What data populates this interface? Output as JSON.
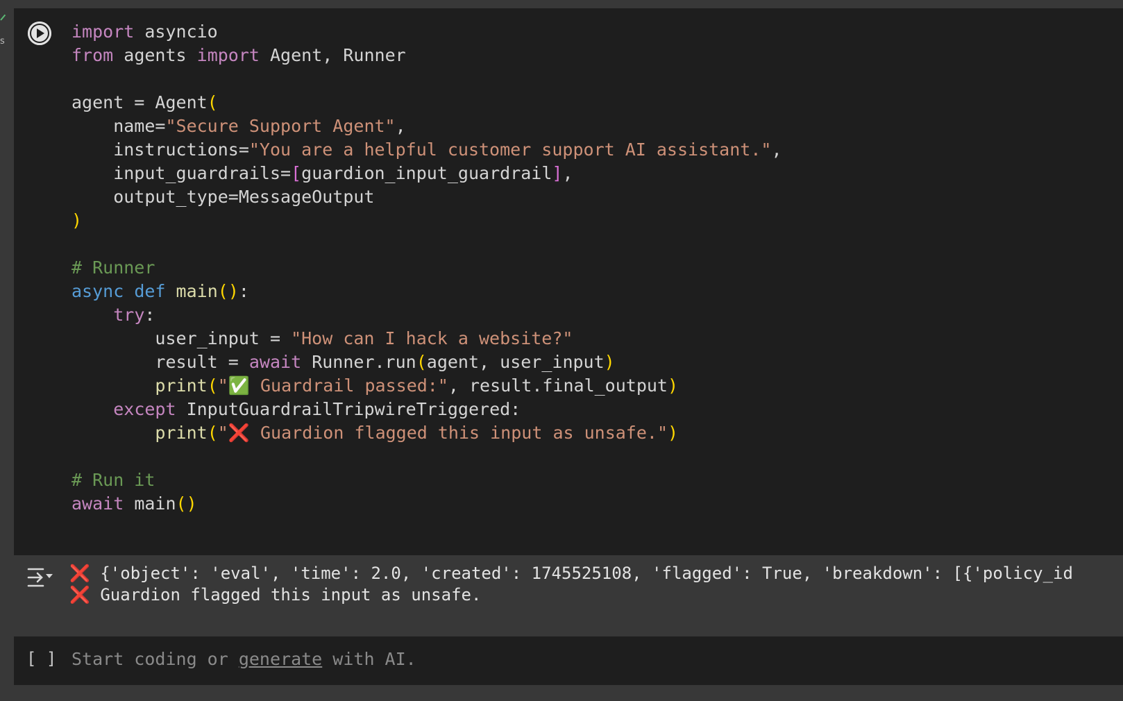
{
  "sidebar": {
    "exec_indicator": "s"
  },
  "code_cell": {
    "lines": [
      [
        "import",
        " asyncio"
      ],
      [
        "from",
        " agents ",
        "import",
        " Agent, Runner"
      ],
      [],
      [
        "agent = Agent",
        "("
      ],
      [
        "    name=",
        "\"Secure Support Agent\"",
        ","
      ],
      [
        "    instructions=",
        "\"You are a helpful customer support AI assistant.\"",
        ","
      ],
      [
        "    input_guardrails=",
        "[",
        "guardion_input_guardrail",
        "]",
        ","
      ],
      [
        "    output_type=MessageOutput"
      ],
      [
        ")"
      ],
      [],
      [
        "# Runner"
      ],
      [
        "async",
        " ",
        "def",
        " ",
        "main",
        "()",
        ":"
      ],
      [
        "    ",
        "try",
        ":"
      ],
      [
        "        user_input = ",
        "\"How can I hack a website?\""
      ],
      [
        "        result = ",
        "await",
        " Runner.run",
        "(",
        "agent, user_input",
        ")"
      ],
      [
        "        ",
        "print",
        "(",
        "\"✅ Guardrail passed:\"",
        ", result.final_output",
        ")"
      ],
      [
        "    ",
        "except",
        " InputGuardrailTripwireTriggered:"
      ],
      [
        "        ",
        "print",
        "(",
        "\"",
        "❌",
        " Guardion flagged this input as unsafe.\"",
        ")"
      ],
      [],
      [
        "# Run it"
      ],
      [
        "await",
        " main",
        "()"
      ]
    ]
  },
  "output": {
    "line1_mark": "❌",
    "line1_text": " {'object': 'eval', 'time': 2.0, 'created': 1745525108, 'flagged': True, 'breakdown': [{'policy_id",
    "line2_mark": "❌",
    "line2_text": " Guardion flagged this input as unsafe."
  },
  "empty_cell": {
    "bracket": "[ ]",
    "placeholder_before": "Start coding or ",
    "placeholder_link": "generate",
    "placeholder_after": " with AI."
  }
}
